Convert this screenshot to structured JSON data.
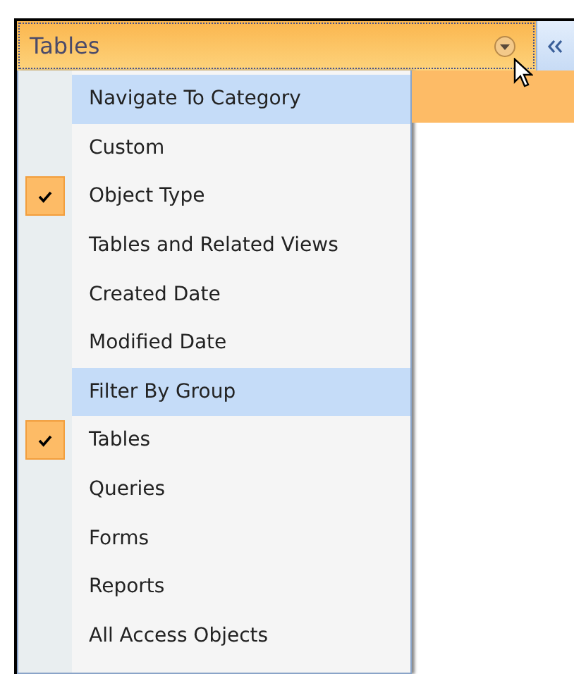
{
  "pane": {
    "title": "Tables"
  },
  "menu": [
    {
      "kind": "header",
      "label": "Navigate To Category"
    },
    {
      "kind": "item",
      "label": "Custom",
      "checked": false
    },
    {
      "kind": "item",
      "label": "Object Type",
      "checked": true
    },
    {
      "kind": "item",
      "label": "Tables and Related Views",
      "checked": false
    },
    {
      "kind": "item",
      "label": "Created Date",
      "checked": false
    },
    {
      "kind": "item",
      "label": "Modified Date",
      "checked": false
    },
    {
      "kind": "header",
      "label": "Filter By Group"
    },
    {
      "kind": "item",
      "label": "Tables",
      "checked": true
    },
    {
      "kind": "item",
      "label": "Queries",
      "checked": false
    },
    {
      "kind": "item",
      "label": "Forms",
      "checked": false
    },
    {
      "kind": "item",
      "label": "Reports",
      "checked": false
    },
    {
      "kind": "item",
      "label": "All Access Objects",
      "checked": false
    }
  ]
}
